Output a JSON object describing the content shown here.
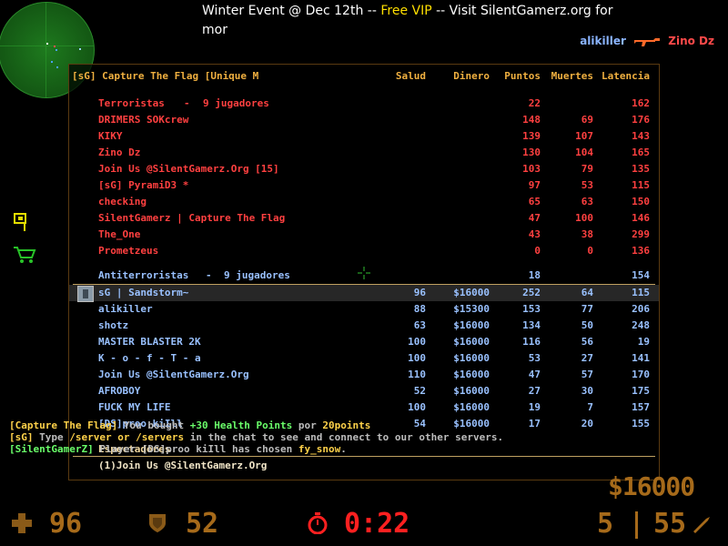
{
  "top_message": {
    "prefix": "Winter Event @ Dec 12th -- ",
    "highlight": "Free VIP",
    "suffix": " -- Visit SilentGamerz.org for",
    "line2": "mor"
  },
  "killfeed": {
    "killer": "alikiller",
    "victim": "Zino Dz",
    "weapon_icon": "rifle-icon"
  },
  "scoreboard": {
    "server_name": "[sG] Capture The Flag [Unique M",
    "columns": [
      "Salud",
      "Dinero",
      "Puntos",
      "Muertes",
      "Latencia"
    ],
    "terrorists": {
      "team_label": "Terroristas",
      "dash": "-",
      "player_count": "9 jugadores",
      "points": "22",
      "latency": "162",
      "players": [
        {
          "name": "DRIMERS SOKcrew",
          "points": "148",
          "deaths": "69",
          "latency": "176"
        },
        {
          "name": "KIKY",
          "points": "139",
          "deaths": "107",
          "latency": "143"
        },
        {
          "name": "Zino Dz",
          "points": "130",
          "deaths": "104",
          "latency": "165"
        },
        {
          "name": "Join Us @SilentGamerz.Org [15]",
          "points": "103",
          "deaths": "79",
          "latency": "135"
        },
        {
          "name": "[sG] PyramiD3 *",
          "points": "97",
          "deaths": "53",
          "latency": "115"
        },
        {
          "name": "checking",
          "points": "65",
          "deaths": "63",
          "latency": "150"
        },
        {
          "name": "SilentGamerz | Capture The Flag",
          "points": "47",
          "deaths": "100",
          "latency": "146"
        },
        {
          "name": "The_One",
          "points": "43",
          "deaths": "38",
          "latency": "299"
        },
        {
          "name": "Prometzeus",
          "points": "0",
          "deaths": "0",
          "latency": "136"
        }
      ]
    },
    "counter_terrorists": {
      "team_label": "Antiterroristas",
      "dash": "-",
      "player_count": "9 jugadores",
      "points": "18",
      "latency": "154",
      "players": [
        {
          "name": "sG | Sandstorm~",
          "health": "96",
          "money": "$16000",
          "points": "252",
          "deaths": "64",
          "latency": "115",
          "selected": true
        },
        {
          "name": "alikiller",
          "health": "88",
          "money": "$15300",
          "points": "153",
          "deaths": "77",
          "latency": "206"
        },
        {
          "name": "shotz",
          "health": "63",
          "money": "$16000",
          "points": "134",
          "deaths": "50",
          "latency": "248"
        },
        {
          "name": "MASTER BLASTER 2K",
          "health": "100",
          "money": "$16000",
          "points": "116",
          "deaths": "56",
          "latency": "19"
        },
        {
          "name": "K - o - f - T - a",
          "health": "100",
          "money": "$16000",
          "points": "53",
          "deaths": "27",
          "latency": "141"
        },
        {
          "name": "Join Us @SilentGamerz.Org",
          "health": "110",
          "money": "$16000",
          "points": "47",
          "deaths": "57",
          "latency": "170"
        },
        {
          "name": "AFROBOY",
          "health": "52",
          "money": "$16000",
          "points": "27",
          "deaths": "30",
          "latency": "175"
        },
        {
          "name": "FUCK MY LIFE",
          "health": "100",
          "money": "$16000",
          "points": "19",
          "deaths": "7",
          "latency": "157"
        },
        {
          "name": "[DS]proo kiIll",
          "health": "54",
          "money": "$16000",
          "points": "17",
          "deaths": "20",
          "latency": "155"
        }
      ]
    },
    "spectators": {
      "label": "Espectadores",
      "entries": [
        "(1)Join Us @SilentGamerz.Org"
      ]
    }
  },
  "chat": [
    {
      "tag": "[Capture The Flag]",
      "parts": [
        {
          "text": " You bought ",
          "color": "w"
        },
        {
          "text": "+30 Health Points",
          "color": "g"
        },
        {
          "text": " por ",
          "color": "w"
        },
        {
          "text": "20points",
          "color": "y"
        }
      ]
    },
    {
      "tag": "[sG]",
      "parts": [
        {
          "text": " Type ",
          "color": "w"
        },
        {
          "text": "/server or /servers",
          "color": "y"
        },
        {
          "text": " in the chat to see and connect to our other servers.",
          "color": "w"
        }
      ]
    },
    {
      "tag": "[SilentGamerZ]",
      "parts": [
        {
          "text": " Player [DS]proo kiIll has chosen ",
          "color": "w"
        },
        {
          "text": "fy_snow",
          "color": "y"
        },
        {
          "text": ".",
          "color": "w"
        }
      ]
    }
  ],
  "hud": {
    "money": "$16000",
    "health": "96",
    "armor": "52",
    "timer": "0:22",
    "ammo_clip": "5",
    "ammo_reserve": "55",
    "health_icon": "cross-icon",
    "armor_icon": "shield-icon",
    "timer_icon": "stopwatch-icon",
    "side_icons": [
      "flag-icon",
      "shopping-cart-icon"
    ],
    "colors": {
      "hud": "#a66a1a",
      "timer": "#ff2020",
      "terrorist": "#ff4040",
      "counter_terrorist": "#99c1ff",
      "header": "#f0b040"
    }
  }
}
